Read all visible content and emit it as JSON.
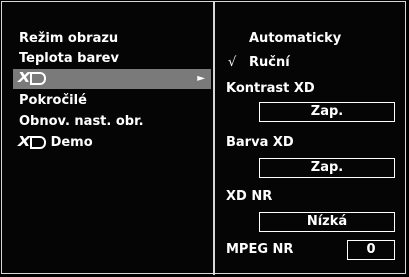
{
  "menu": {
    "items": [
      {
        "label": "Režim obrazu"
      },
      {
        "label": "Teplota barev"
      },
      {
        "label": "XD",
        "selected": true,
        "icon": "xd-logo"
      },
      {
        "label": "Pokročilé"
      },
      {
        "label": "Obnov. nast. obr."
      },
      {
        "label": "Demo",
        "icon": "xd-logo"
      }
    ],
    "arrow": "►"
  },
  "submenu": {
    "auto_label": "Automaticky",
    "check_mark": "√",
    "manual_label": "Ruční",
    "contrast_label": "Kontrast XD",
    "contrast_value": "Zap.",
    "color_label": "Barva XD",
    "color_value": "Zap.",
    "nr_label": "XD NR",
    "nr_value": "Nízká",
    "mpeg_label": "MPEG NR",
    "mpeg_value": "0"
  }
}
